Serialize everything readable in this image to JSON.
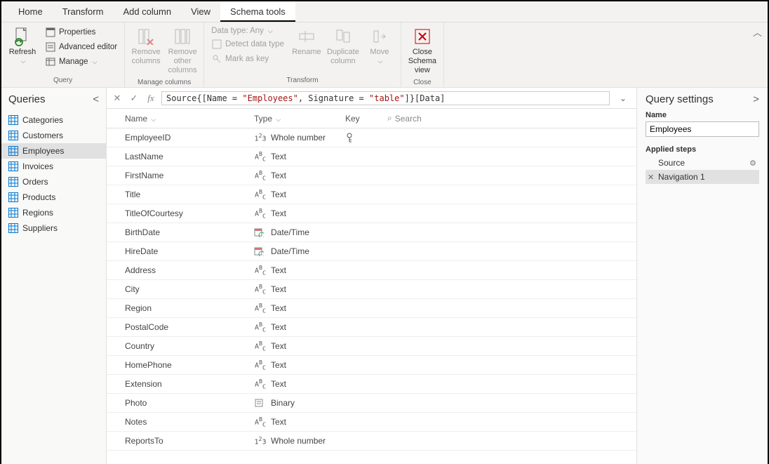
{
  "tabs": [
    "Home",
    "Transform",
    "Add column",
    "View",
    "Schema tools"
  ],
  "active_tab": 4,
  "ribbon": {
    "refresh": "Refresh",
    "properties": "Properties",
    "advanced_editor": "Advanced editor",
    "manage": "Manage",
    "remove_columns": "Remove columns",
    "remove_other_columns": "Remove other columns",
    "data_type": "Data type: Any",
    "detect_data_type": "Detect data type",
    "mark_as_key": "Mark as key",
    "rename": "Rename",
    "duplicate_column": "Duplicate column",
    "move": "Move",
    "close_schema_view": "Close Schema view",
    "groups": {
      "query": "Query",
      "manage_columns": "Manage columns",
      "transform": "Transform",
      "close": "Close"
    }
  },
  "formula": {
    "prefix": "Source{[Name = ",
    "s1": "\"Employees\"",
    "mid": ", Signature = ",
    "s2": "\"table\"",
    "suffix": "]}[Data]"
  },
  "queries_pane": {
    "title": "Queries"
  },
  "queries": [
    "Categories",
    "Customers",
    "Employees",
    "Invoices",
    "Orders",
    "Products",
    "Regions",
    "Suppliers"
  ],
  "selected_query": 2,
  "grid": {
    "headers": {
      "name": "Name",
      "type": "Type",
      "key": "Key",
      "search": "Search"
    },
    "rows": [
      {
        "name": "EmployeeID",
        "type_label": "Whole number",
        "type_icon": "number",
        "key": true
      },
      {
        "name": "LastName",
        "type_label": "Text",
        "type_icon": "text",
        "key": false
      },
      {
        "name": "FirstName",
        "type_label": "Text",
        "type_icon": "text",
        "key": false
      },
      {
        "name": "Title",
        "type_label": "Text",
        "type_icon": "text",
        "key": false
      },
      {
        "name": "TitleOfCourtesy",
        "type_label": "Text",
        "type_icon": "text",
        "key": false
      },
      {
        "name": "BirthDate",
        "type_label": "Date/Time",
        "type_icon": "datetime",
        "key": false
      },
      {
        "name": "HireDate",
        "type_label": "Date/Time",
        "type_icon": "datetime",
        "key": false
      },
      {
        "name": "Address",
        "type_label": "Text",
        "type_icon": "text",
        "key": false
      },
      {
        "name": "City",
        "type_label": "Text",
        "type_icon": "text",
        "key": false
      },
      {
        "name": "Region",
        "type_label": "Text",
        "type_icon": "text",
        "key": false
      },
      {
        "name": "PostalCode",
        "type_label": "Text",
        "type_icon": "text",
        "key": false
      },
      {
        "name": "Country",
        "type_label": "Text",
        "type_icon": "text",
        "key": false
      },
      {
        "name": "HomePhone",
        "type_label": "Text",
        "type_icon": "text",
        "key": false
      },
      {
        "name": "Extension",
        "type_label": "Text",
        "type_icon": "text",
        "key": false
      },
      {
        "name": "Photo",
        "type_label": "Binary",
        "type_icon": "binary",
        "key": false
      },
      {
        "name": "Notes",
        "type_label": "Text",
        "type_icon": "text",
        "key": false
      },
      {
        "name": "ReportsTo",
        "type_label": "Whole number",
        "type_icon": "number",
        "key": false
      }
    ]
  },
  "settings": {
    "title": "Query settings",
    "name_label": "Name",
    "name_value": "Employees",
    "applied_steps_label": "Applied steps",
    "steps": [
      {
        "label": "Source",
        "deletable": false,
        "gear": true
      },
      {
        "label": "Navigation 1",
        "deletable": true,
        "gear": false
      }
    ],
    "selected_step": 1
  }
}
